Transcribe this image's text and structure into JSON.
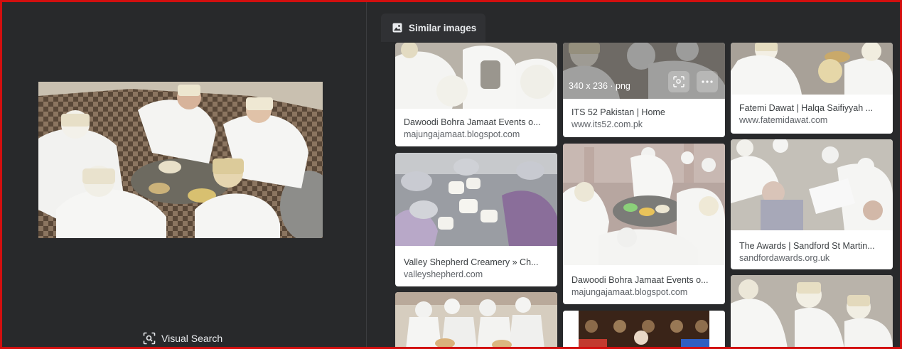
{
  "visual_search": {
    "label": "Visual Search",
    "icon": "visual-search-icon"
  },
  "tab": {
    "label": "Similar images",
    "icon": "image-icon"
  },
  "results": [
    {
      "title": "Dawoodi Bohra Jamaat Events o...",
      "domain": "majungajamaat.blogspot.com"
    },
    {
      "title": "ITS 52 Pakistan | Home",
      "domain": "www.its52.com.pk",
      "size": "340 x 236 · png"
    },
    {
      "title": "Fatemi Dawat | Halqa Saifiyyah ...",
      "domain": "www.fatemidawat.com"
    },
    {
      "title": "Valley Shepherd Creamery » Ch...",
      "domain": "valleyshepherd.com"
    },
    {
      "title": "Dawoodi Bohra Jamaat Events o...",
      "domain": "majungajamaat.blogspot.com"
    },
    {
      "title": "The Awards | Sandford St Martin...",
      "domain": "sandfordawards.org.uk"
    }
  ],
  "overlay_icons": [
    "lens-icon",
    "more-icon"
  ]
}
